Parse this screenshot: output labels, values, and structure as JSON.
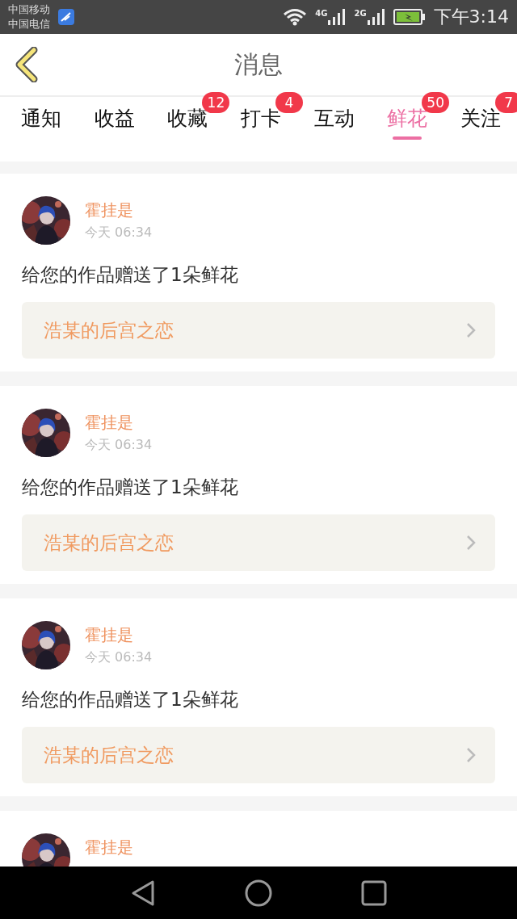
{
  "status_bar": {
    "carriers": [
      "中国移动",
      "中国电信"
    ],
    "network_1": "4G",
    "network_2": "2G",
    "time": "下午3:14"
  },
  "header": {
    "title": "消息"
  },
  "tabs": [
    {
      "label": "通知",
      "selected": false
    },
    {
      "label": "收益",
      "selected": false
    },
    {
      "label": "收藏",
      "selected": false,
      "badge": "12"
    },
    {
      "label": "打卡",
      "selected": false,
      "badge": "4"
    },
    {
      "label": "互动",
      "selected": false
    },
    {
      "label": "鲜花",
      "selected": true,
      "badge": "50"
    },
    {
      "label": "关注",
      "selected": false,
      "badge": "7"
    }
  ],
  "messages": [
    {
      "user": "霍挂是",
      "time": "今天 06:34",
      "text": "给您的作品赠送了1朵鲜花",
      "work": "浩某的后宫之恋"
    },
    {
      "user": "霍挂是",
      "time": "今天 06:34",
      "text": "给您的作品赠送了1朵鲜花",
      "work": "浩某的后宫之恋"
    },
    {
      "user": "霍挂是",
      "time": "今天 06:34",
      "text": "给您的作品赠送了1朵鲜花",
      "work": "浩某的后宫之恋"
    },
    {
      "user": "霍挂是"
    }
  ]
}
